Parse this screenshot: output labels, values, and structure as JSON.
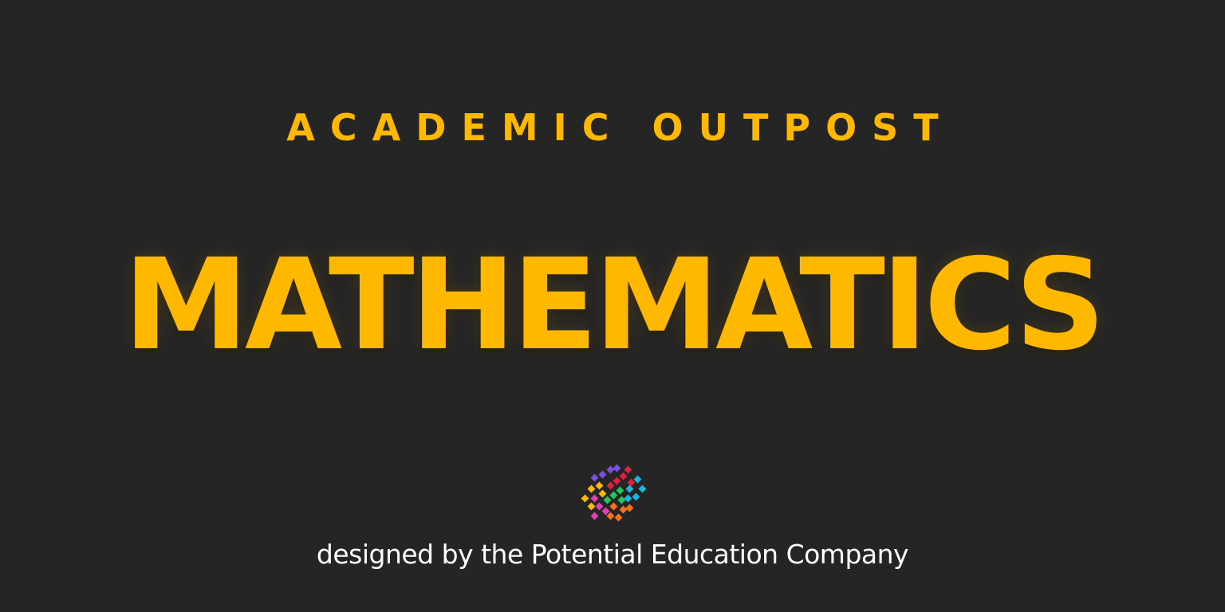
{
  "header": {
    "brand": "ACADEMIC OUTPOST"
  },
  "main": {
    "title": "MATHEMATICS"
  },
  "footer": {
    "credit": "designed by the Potential Education Company"
  },
  "logo": {
    "icon": "potential-education-logo-icon",
    "colors": [
      "#7B4FE0",
      "#E0213A",
      "#1BB6E0",
      "#22C55E",
      "#FFB800",
      "#E23FB5",
      "#F97316"
    ]
  },
  "colors": {
    "background": "#252525",
    "accent": "#FFB800",
    "text": "#FFFFFF"
  }
}
